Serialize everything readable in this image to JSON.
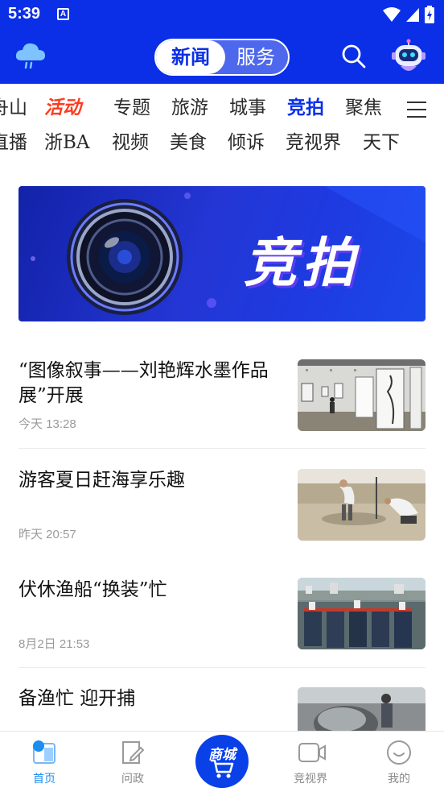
{
  "status_bar": {
    "time": "5:39",
    "notification": "A"
  },
  "header": {
    "tabs": [
      {
        "label": "新闻",
        "selected": true
      },
      {
        "label": "服务",
        "selected": false
      }
    ],
    "weather_icon": "cloud-rain-icon",
    "search_icon": "search-icon",
    "assistant_icon": "robot-icon"
  },
  "categories": {
    "row1": [
      "舟山",
      "活动",
      "专题",
      "旅游",
      "城事",
      "竞拍",
      "聚焦"
    ],
    "row2": [
      "直播",
      "浙BA",
      "视频",
      "美食",
      "倾诉",
      "竞视界",
      "天下"
    ],
    "active": "竞拍",
    "highlighted": "活动",
    "menu_icon": "menu-icon"
  },
  "banner": {
    "text": "竞拍"
  },
  "news": [
    {
      "title": "“图像叙事——刘艳辉水墨作品展”开展",
      "time": "今天 13:28"
    },
    {
      "title": "游客夏日赶海享乐趣",
      "time": "昨天 20:57"
    },
    {
      "title": "伏休渔船“换装”忙",
      "time": "8月2日 21:53"
    },
    {
      "title": "备渔忙 迎开捕",
      "time": ""
    }
  ],
  "bottom_nav": {
    "home": "首页",
    "politics": "问政",
    "mall": "商城",
    "video": "竞视界",
    "mine": "我的"
  },
  "colors": {
    "brand_blue": "#0a2fe6",
    "hot_red": "#ff3b1f",
    "nav_active": "#1b8ef0"
  }
}
